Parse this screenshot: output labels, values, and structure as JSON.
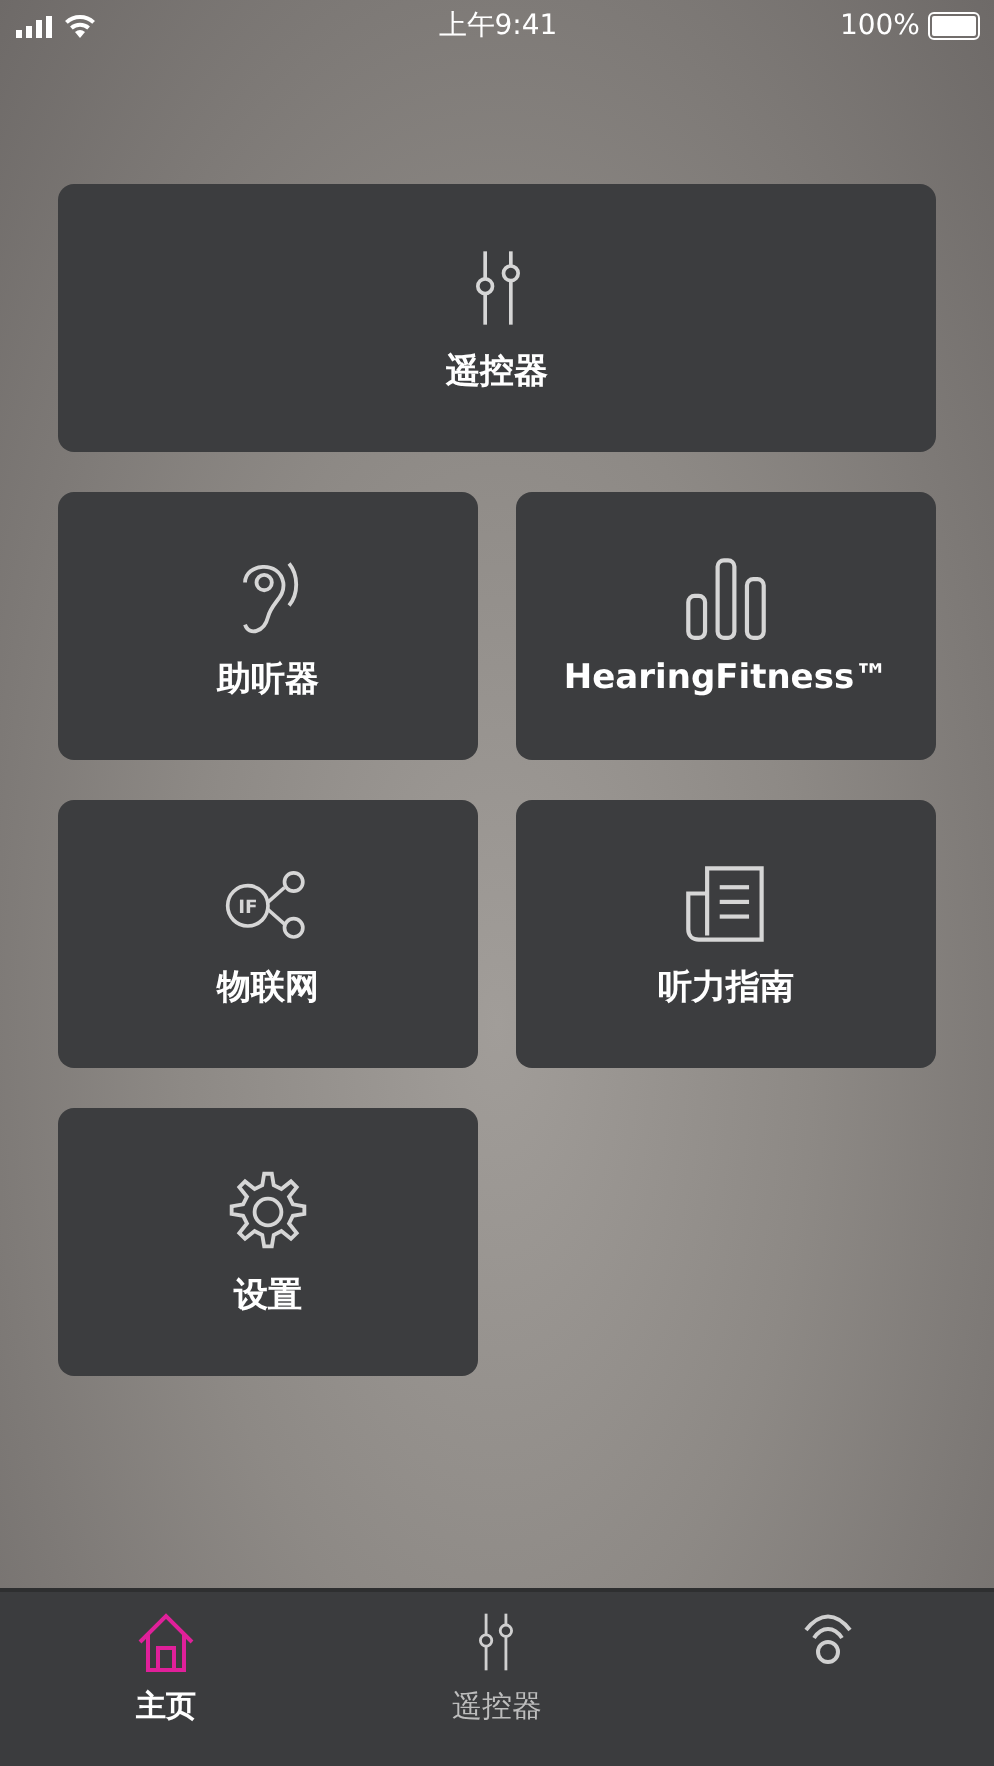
{
  "status_bar": {
    "time": "上午9:41",
    "battery": "100%"
  },
  "tiles": [
    {
      "kind": "sliders",
      "label": "遥控器",
      "wide": true
    },
    {
      "kind": "ear",
      "label": "助听器",
      "wide": false
    },
    {
      "kind": "bars",
      "label": "HearingFitness™",
      "wide": false
    },
    {
      "kind": "network",
      "icon_text": "IF",
      "label": "物联网",
      "wide": false
    },
    {
      "kind": "guide",
      "label": "听力指南",
      "wide": false
    },
    {
      "kind": "gear",
      "label": "设置",
      "wide": false
    }
  ],
  "tabs": [
    {
      "kind": "home",
      "label": "主页",
      "selected": true
    },
    {
      "kind": "sliders",
      "label": "遥控器",
      "selected": false
    },
    {
      "kind": "signal",
      "selected": false
    }
  ]
}
